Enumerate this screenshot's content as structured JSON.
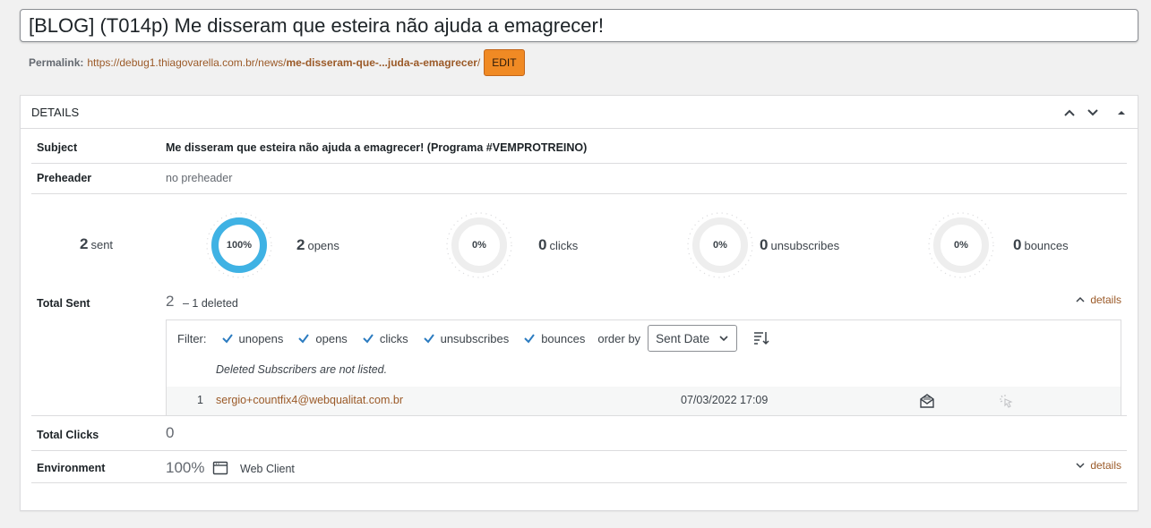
{
  "post": {
    "title": "[BLOG] (T014p) Me disseram que esteira não ajuda a emagrecer!",
    "permalink_label": "Permalink:",
    "permalink_base": "https://debug1.thiagovarella.com.br/news/",
    "permalink_slug": "me-disseram-que-...juda-a-emagrecer",
    "permalink_trailing": "/",
    "edit_label": "EDIT"
  },
  "details": {
    "title": "DETAILS",
    "subject_label": "Subject",
    "subject_value": "Me disseram que esteira não ajuda a emagrecer! (Programa #VEMPROTREINO)",
    "preheader_label": "Preheader",
    "preheader_value": "no preheader",
    "stats": {
      "sent_num": "2",
      "sent_unit": "sent",
      "opens_pct": "100%",
      "opens_pct_value": 100,
      "opens_num": "2",
      "opens_unit": "opens",
      "clicks_pct": "0%",
      "clicks_pct_value": 0,
      "clicks_num": "0",
      "clicks_unit": "clicks",
      "unsub_pct": "0%",
      "unsub_pct_value": 0,
      "unsub_num": "0",
      "unsub_unit": "unsubscribes",
      "bounces_pct": "0%",
      "bounces_pct_value": 0,
      "bounces_num": "0",
      "bounces_unit": "bounces"
    },
    "total_sent_label": "Total Sent",
    "total_sent_count": "2",
    "total_sent_deleted": "– 1 deleted",
    "details_link": "details",
    "filter": {
      "label": "Filter:",
      "options": [
        "unopens",
        "opens",
        "clicks",
        "unsubscribes",
        "bounces"
      ],
      "order_label": "order by",
      "order_value": "Sent Date"
    },
    "deleted_note": "Deleted Subscribers are not listed.",
    "subscriber": {
      "index": "1",
      "email": "sergio+countfix4@webqualitat.com.br",
      "date": "07/03/2022 17:09"
    },
    "total_clicks_label": "Total Clicks",
    "total_clicks_value": "0",
    "environment_label": "Environment",
    "environment_pct": "100%",
    "environment_client": "Web Client",
    "environment_details_link": "details"
  },
  "colors": {
    "accent_ring": "#3fb2e4",
    "ring_track": "#eeeeee",
    "link": "#9b5a28",
    "check": "#2b7bc0",
    "edit_button": "#f08a24"
  }
}
